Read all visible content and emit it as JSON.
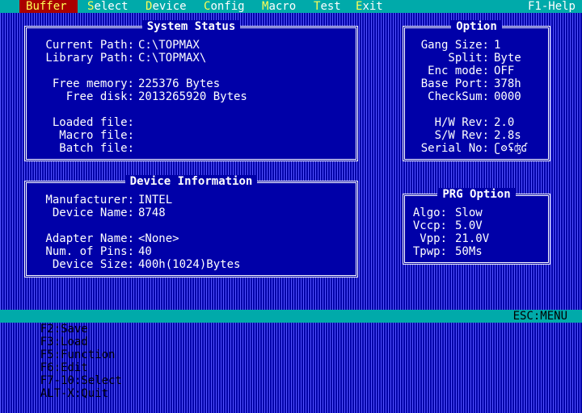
{
  "menubar": {
    "items": [
      {
        "hot": "B",
        "rest": "uffer",
        "active": true
      },
      {
        "hot": "S",
        "rest": "elect"
      },
      {
        "hot": "D",
        "rest": "evice"
      },
      {
        "hot": "C",
        "rest": "onfig"
      },
      {
        "hot": "M",
        "rest": "acro"
      },
      {
        "hot": "T",
        "rest": "est"
      },
      {
        "hot": "E",
        "rest": "xit"
      }
    ],
    "help": "F1-Help"
  },
  "system_status": {
    "title": "System Status",
    "current_path_label": "Current Path:",
    "current_path": "C:\\TOPMAX",
    "library_path_label": "Library Path:",
    "library_path": "C:\\TOPMAX\\",
    "free_memory_label": "Free memory:",
    "free_memory": "225376 Bytes",
    "free_disk_label": "Free disk:",
    "free_disk": "2013265920 Bytes",
    "loaded_file_label": "Loaded file:",
    "loaded_file": "",
    "macro_file_label": "Macro file:",
    "macro_file": "",
    "batch_file_label": "Batch file:",
    "batch_file": ""
  },
  "device_info": {
    "title": "Device Information",
    "manufacturer_label": "Manufacturer:",
    "manufacturer": "INTEL",
    "device_name_label": "Device Name:",
    "device_name": "8748",
    "adapter_name_label": "Adapter Name:",
    "adapter_name": "<None>",
    "num_pins_label": "Num. of Pins:",
    "num_pins": "40",
    "device_size_label": "Device Size:",
    "device_size": "400h(1024)Bytes"
  },
  "option": {
    "title": "Option",
    "gang_size_label": "Gang Size:",
    "gang_size": "1",
    "split_label": "Split:",
    "split": "Byte",
    "enc_mode_label": "Enc mode:",
    "enc_mode": "OFF",
    "base_port_label": "Base Port:",
    "base_port": "378h",
    "checksum_label": "CheckSum:",
    "checksum": "0000",
    "hw_rev_label": "H/W Rev:",
    "hw_rev": "2.0",
    "sw_rev_label": "S/W Rev:",
    "sw_rev": "2.8s",
    "serial_no_label": "Serial No:",
    "serial_no": "ʗʘʢʤʛ"
  },
  "prg_option": {
    "title": "PRG Option",
    "algo_label": "Algo:",
    "algo": "Slow",
    "vccp_label": "Vccp:",
    "vccp": "5.0V",
    "vpp_label": "Vpp:",
    "vpp": "21.0V",
    "tpwp_label": "Tpwp:",
    "tpwp": "50Ms"
  },
  "status_bar": {
    "keys": [
      "F2:Save",
      "F3:Load",
      "F5:Function",
      "F6:Edit",
      "F7-10:Select",
      "ALT-X:Quit"
    ],
    "esc": "ESC:MENU"
  },
  "colors": {
    "background": "#0000a8",
    "menubar": "#00aaaa",
    "active_menu": "#aa0000",
    "hotkey": "#ffff55",
    "text": "#ffffff"
  }
}
